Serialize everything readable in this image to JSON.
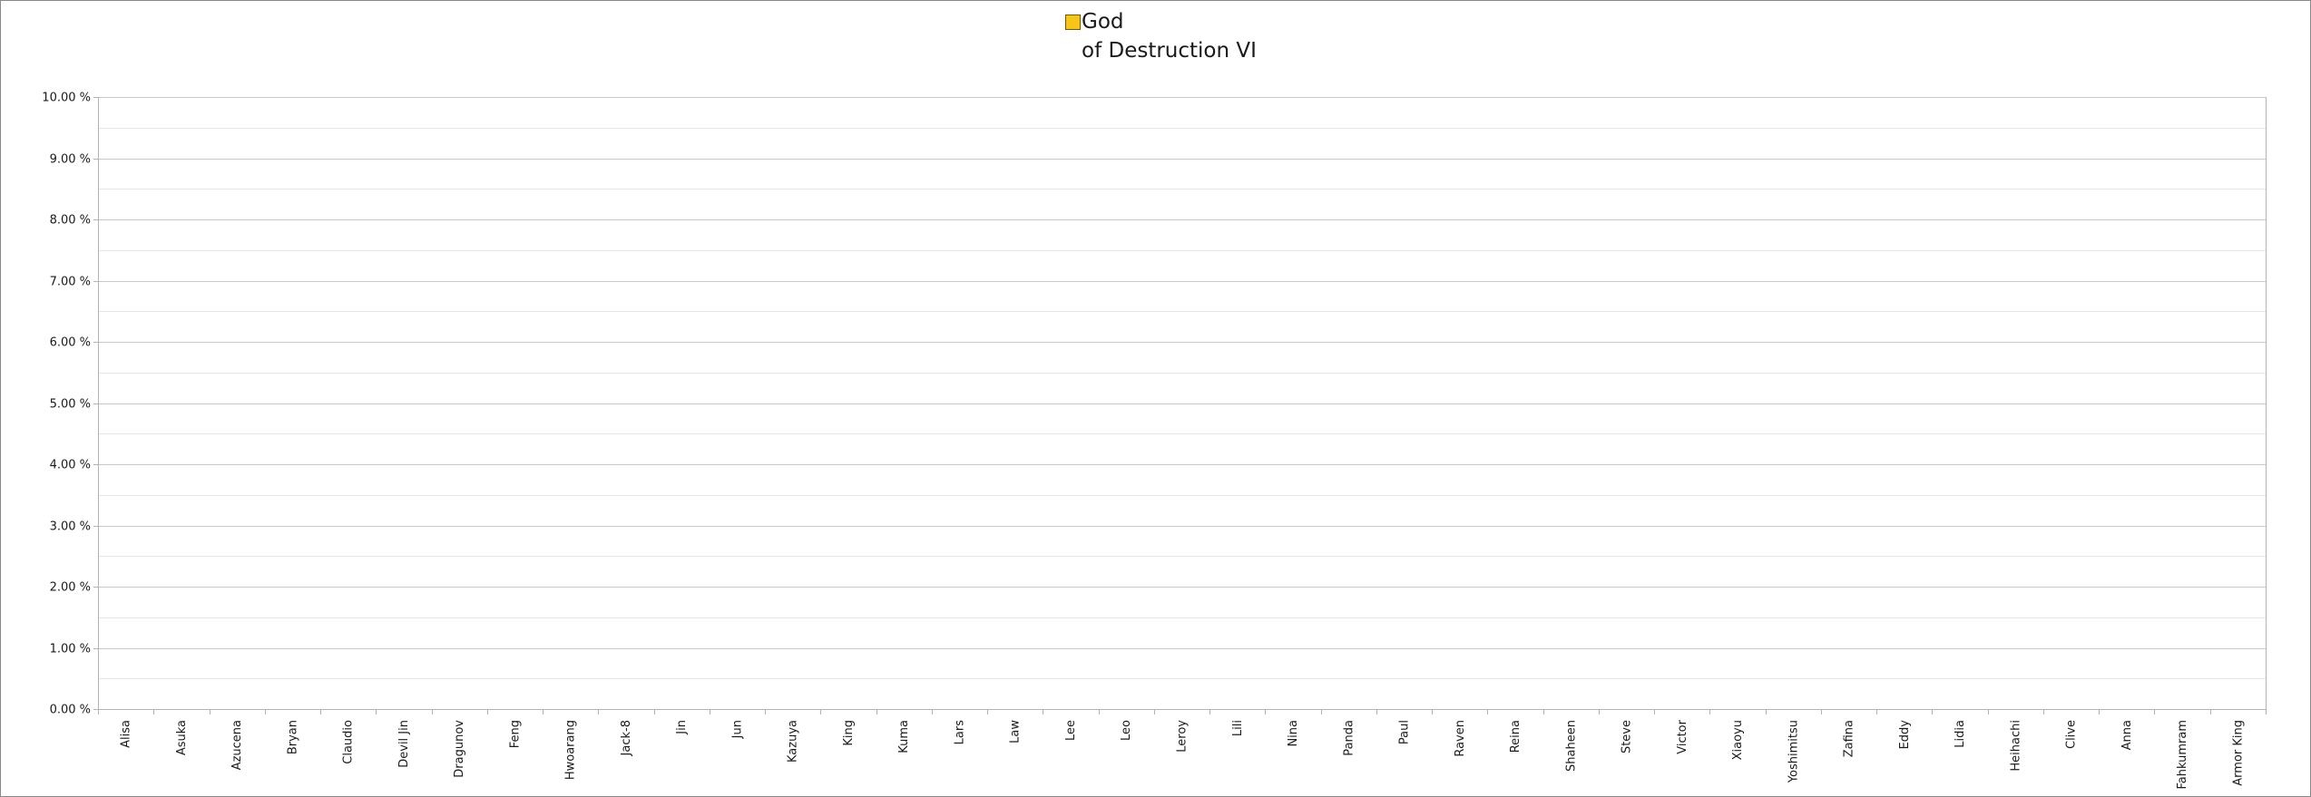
{
  "chart_data": {
    "type": "bar",
    "title": "",
    "xlabel": "",
    "ylabel": "",
    "ylim": [
      0,
      10
    ],
    "y_tick_step": 1,
    "y_tick_labels": [
      "0.00 %",
      "1.00 %",
      "2.00 %",
      "3.00 %",
      "4.00 %",
      "5.00 %",
      "6.00 %",
      "7.00 %",
      "8.00 %",
      "9.00 %",
      "10.00 %"
    ],
    "grid": true,
    "legend_position": "top-center",
    "categories": [
      "Alisa",
      "Asuka",
      "Azucena",
      "Bryan",
      "Claudio",
      "Devil Jin",
      "Dragunov",
      "Feng",
      "Hwoarang",
      "Jack-8",
      "Jin",
      "Jun",
      "Kazuya",
      "King",
      "Kuma",
      "Lars",
      "Law",
      "Lee",
      "Leo",
      "Leroy",
      "Lili",
      "Nina",
      "Panda",
      "Paul",
      "Raven",
      "Reina",
      "Shaheen",
      "Steve",
      "Victor",
      "Xiaoyu",
      "Yoshimitsu",
      "Zafina",
      "Eddy",
      "Lidia",
      "Heihachi",
      "Clive",
      "Anna",
      "Fahkumram",
      "Armor King"
    ],
    "series": [
      {
        "name": "God\nof Destruction VI",
        "color": "#f5c518",
        "values": [
          0,
          0,
          0,
          0,
          0,
          0,
          0,
          0,
          0,
          0,
          0,
          0,
          0,
          0,
          0,
          0,
          0,
          0,
          0,
          0,
          0,
          0,
          0,
          0,
          0,
          0,
          0,
          0,
          0,
          0,
          0,
          0,
          0,
          0,
          0,
          0,
          0,
          0,
          0
        ]
      }
    ],
    "colors": {
      "grid_major": "#c8c8c8",
      "grid_minor": "#e6e6e6",
      "axis": "#b3b3b3"
    }
  }
}
